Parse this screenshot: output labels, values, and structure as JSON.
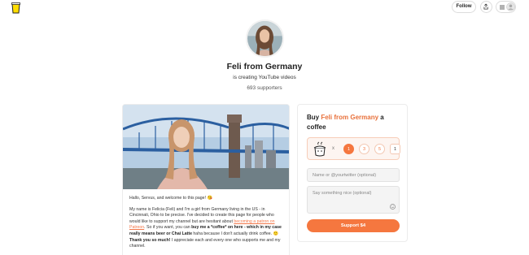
{
  "header": {
    "logo_icon": "coffee-cup-logo-icon",
    "follow_label": "Follow",
    "share_icon": "share-icon",
    "menu_icon": "hamburger-menu-icon",
    "avatar_icon": "user-avatar-icon"
  },
  "profile": {
    "name": "Feli from Germany",
    "tagline": "is creating YouTube videos",
    "supporters": "693 supporters"
  },
  "post": {
    "greeting": "Hallo, Servus, and welcome to this page! 😘",
    "para_1_a": "My name is Felicia (Feli) and I'm a girl from Germany living in the US - in Cincinnati, Ohio to be precise. I've decided to create this page for people who would like to support my channel but are hesitant about ",
    "para_1_link": "becoming a patron on Patreon",
    "para_1_b": ". So if you want, you can ",
    "para_1_bold_1": "buy me a *coffee* on here - which in my case really means beer or Chai Latte",
    "para_1_c": " haha because I don't actually drink coffee. 🙂 ",
    "para_1_bold_2": "Thank you so much!",
    "para_1_d": " I appreciate each and every one who supports me and my channel."
  },
  "buy": {
    "title_prefix": "Buy ",
    "title_name": "Feli from Germany",
    "title_suffix": " a coffee",
    "multiplier": "x",
    "quantities": [
      "1",
      "3",
      "5"
    ],
    "custom_quantity": "1",
    "name_placeholder": "Name or @yourtwitter (optional)",
    "message_placeholder": "Say something nice (optional)",
    "support_label": "Support $4",
    "accent_color": "#f5773f"
  }
}
